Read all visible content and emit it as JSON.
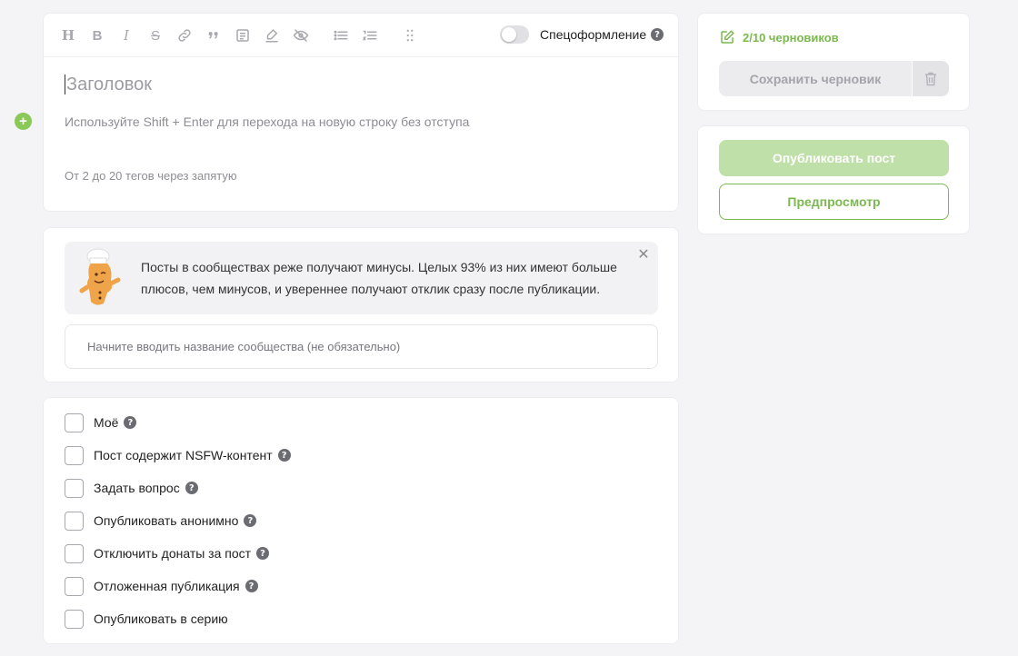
{
  "editor": {
    "toolbar": {
      "heading_icon": "H",
      "bold_icon": "B",
      "italic_icon": "I",
      "strike_icon": "S",
      "special_formatting_label": "Спецоформление"
    },
    "title_placeholder": "Заголовок",
    "body_placeholder": "Используйте Shift + Enter для перехода на новую строку без отступа",
    "tags_placeholder": "От 2 до 20 тегов через запятую"
  },
  "community": {
    "notice_text": "Посты в сообществах реже получают минусы. Целых 93% из них имеют больше плюсов, чем минусов, и увереннее получают отклик сразу после публикации.",
    "input_placeholder": "Начните вводить название сообщества (не обязательно)"
  },
  "options": [
    {
      "label": "Моё",
      "help": true
    },
    {
      "label": "Пост содержит NSFW-контент",
      "help": true
    },
    {
      "label": "Задать вопрос",
      "help": true
    },
    {
      "label": "Опубликовать анонимно",
      "help": true
    },
    {
      "label": "Отключить донаты за пост",
      "help": true
    },
    {
      "label": "Отложенная публикация",
      "help": true
    },
    {
      "label": "Опубликовать в серию",
      "help": false
    }
  ],
  "drafts": {
    "count_label": "2/10 черновиков",
    "save_label": "Сохранить черновик"
  },
  "publish": {
    "publish_label": "Опубликовать пост",
    "preview_label": "Предпросмотр"
  },
  "colors": {
    "accent": "#7bb850",
    "accent_light": "#bfe0a8",
    "background": "#f4f4f6"
  }
}
